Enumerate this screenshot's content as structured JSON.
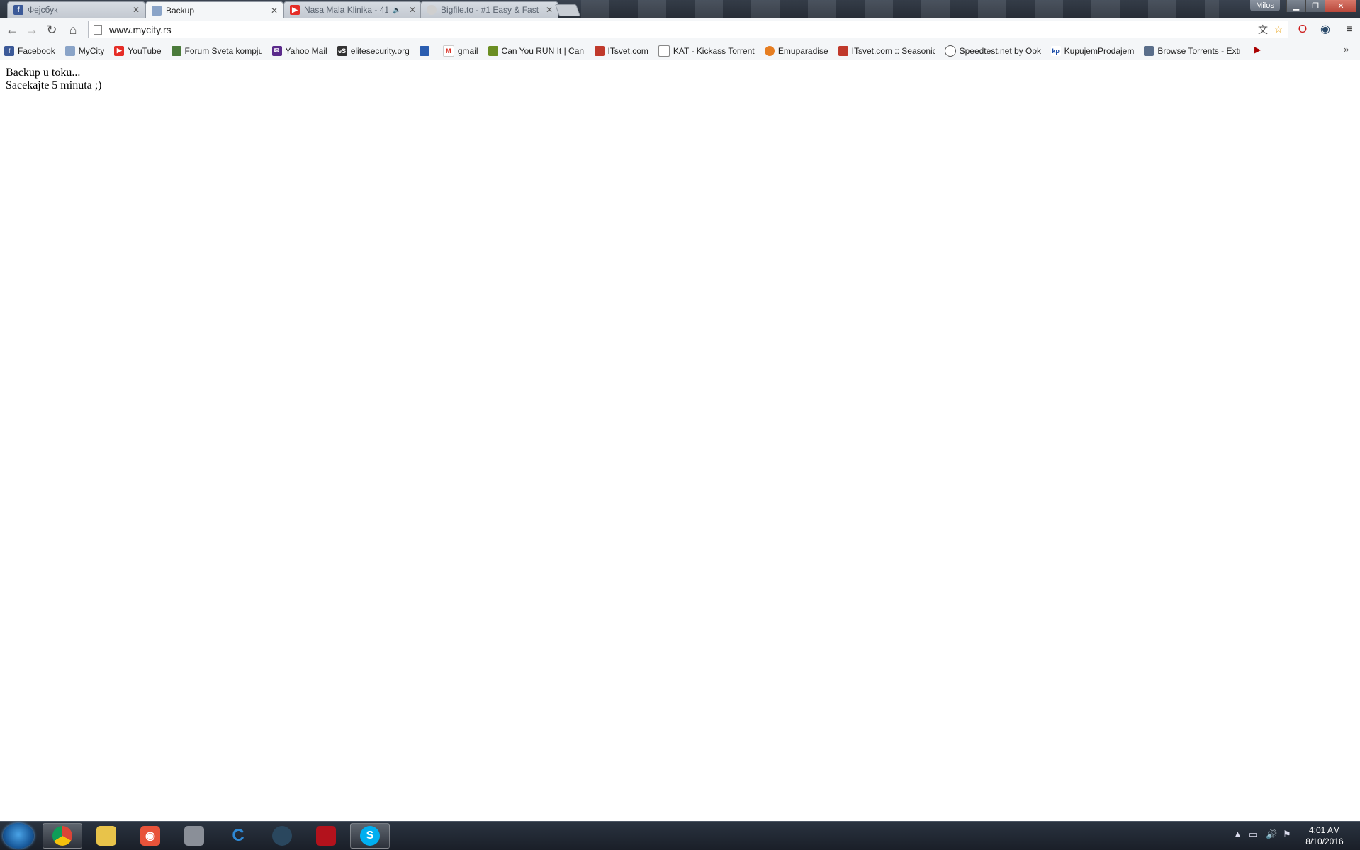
{
  "tabs": [
    {
      "title": "Фејсбук",
      "favicon": "facebook-icon",
      "color": "#3b5998",
      "active": false
    },
    {
      "title": "Backup",
      "favicon": "page-icon",
      "color": "#8aa4c8",
      "active": true
    },
    {
      "title": "Nasa Mala Klinika - 41",
      "favicon": "youtube-icon",
      "color": "#e52d27",
      "active": false
    },
    {
      "title": "Bigfile.to - #1 Easy & Fast",
      "favicon": "bigfile-icon",
      "color": "#999999",
      "active": false
    }
  ],
  "window": {
    "user": "Milos"
  },
  "omnibox": {
    "url": "www.mycity.rs"
  },
  "bookmarks": [
    {
      "label": "Facebook",
      "icon": "facebook-icon",
      "color": "#3b5998"
    },
    {
      "label": "MyCity",
      "icon": "mycity-icon",
      "color": "#8aa4c8"
    },
    {
      "label": "YouTube",
      "icon": "youtube-icon",
      "color": "#e52d27"
    },
    {
      "label": "Forum Sveta kompjut",
      "icon": "forum-icon",
      "color": "#4a7a3a"
    },
    {
      "label": "Yahoo Mail",
      "icon": "mail-icon",
      "color": "#5b2b8c"
    },
    {
      "label": "elitesecurity.org",
      "icon": "es-icon",
      "color": "#333333"
    },
    {
      "label": "",
      "icon": "bookmark-blue-icon",
      "color": "#2a5db0"
    },
    {
      "label": "gmail",
      "icon": "gmail-icon",
      "color": "#d93025"
    },
    {
      "label": "Can You RUN It | Can",
      "icon": "canyourunit-icon",
      "color": "#6b8e23"
    },
    {
      "label": "ITsvet.com",
      "icon": "itsvet-icon",
      "color": "#c0392b"
    },
    {
      "label": "KAT - Kickass Torrents",
      "icon": "page-icon",
      "color": "#ffffff"
    },
    {
      "label": "Emuparadise",
      "icon": "emuparadise-icon",
      "color": "#e67e22"
    },
    {
      "label": "ITsvet.com :: Seasonic",
      "icon": "itsvet-icon",
      "color": "#c0392b"
    },
    {
      "label": "Speedtest.net by Ook",
      "icon": "speedtest-icon",
      "color": "#555555"
    },
    {
      "label": "KupujemProdajem",
      "icon": "kp-icon",
      "color": "#1e4fa8"
    },
    {
      "label": "Browse Torrents - Extr",
      "icon": "extratorrent-icon",
      "color": "#5a6e8a"
    }
  ],
  "page": {
    "line1": "Backup u toku...",
    "line2": "Sacekajte 5 minuta ;)"
  },
  "taskbar": {
    "apps": [
      {
        "name": "chrome-icon",
        "active": true,
        "color": "#4caf50"
      },
      {
        "name": "explorer-icon",
        "active": false,
        "color": "#e8c34a"
      },
      {
        "name": "recorder-icon",
        "active": false,
        "color": "#e8533a"
      },
      {
        "name": "archive-icon",
        "active": false,
        "color": "#8a8f98"
      },
      {
        "name": "steam-c-icon",
        "active": false,
        "color": "#1f6fb0"
      },
      {
        "name": "steam-icon",
        "active": false,
        "color": "#2a475e"
      },
      {
        "name": "msi-afterburner-icon",
        "active": false,
        "color": "#b3121c"
      },
      {
        "name": "skype-icon",
        "active": true,
        "color": "#00aff0"
      }
    ],
    "time": "4:01 AM",
    "date": "8/10/2016"
  }
}
